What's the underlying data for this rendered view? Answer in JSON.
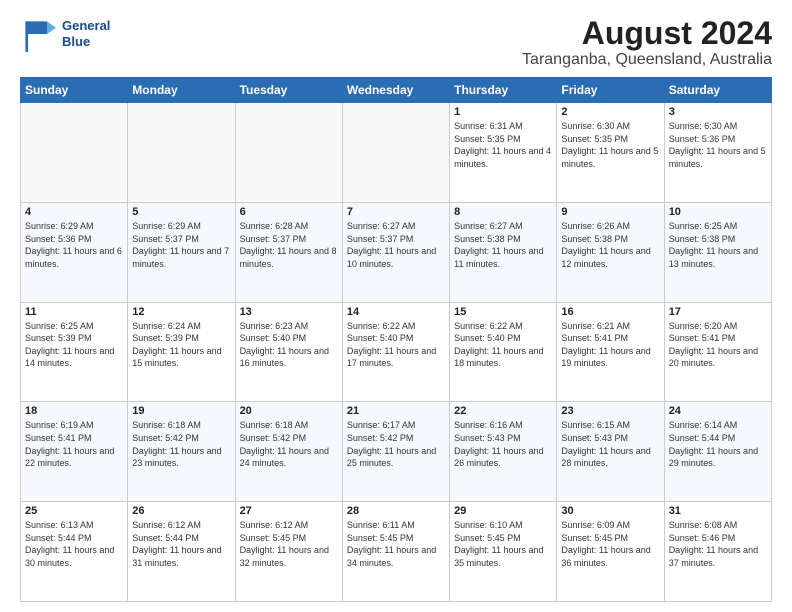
{
  "header": {
    "logo": {
      "line1": "General",
      "line2": "Blue"
    },
    "title": "August 2024",
    "subtitle": "Taranganba, Queensland, Australia"
  },
  "weekdays": [
    "Sunday",
    "Monday",
    "Tuesday",
    "Wednesday",
    "Thursday",
    "Friday",
    "Saturday"
  ],
  "weeks": [
    [
      {
        "day": "",
        "info": ""
      },
      {
        "day": "",
        "info": ""
      },
      {
        "day": "",
        "info": ""
      },
      {
        "day": "",
        "info": ""
      },
      {
        "day": "1",
        "info": "Sunrise: 6:31 AM\nSunset: 5:35 PM\nDaylight: 11 hours\nand 4 minutes."
      },
      {
        "day": "2",
        "info": "Sunrise: 6:30 AM\nSunset: 5:35 PM\nDaylight: 11 hours\nand 5 minutes."
      },
      {
        "day": "3",
        "info": "Sunrise: 6:30 AM\nSunset: 5:36 PM\nDaylight: 11 hours\nand 5 minutes."
      }
    ],
    [
      {
        "day": "4",
        "info": "Sunrise: 6:29 AM\nSunset: 5:36 PM\nDaylight: 11 hours\nand 6 minutes."
      },
      {
        "day": "5",
        "info": "Sunrise: 6:29 AM\nSunset: 5:37 PM\nDaylight: 11 hours\nand 7 minutes."
      },
      {
        "day": "6",
        "info": "Sunrise: 6:28 AM\nSunset: 5:37 PM\nDaylight: 11 hours\nand 8 minutes."
      },
      {
        "day": "7",
        "info": "Sunrise: 6:27 AM\nSunset: 5:37 PM\nDaylight: 11 hours\nand 10 minutes."
      },
      {
        "day": "8",
        "info": "Sunrise: 6:27 AM\nSunset: 5:38 PM\nDaylight: 11 hours\nand 11 minutes."
      },
      {
        "day": "9",
        "info": "Sunrise: 6:26 AM\nSunset: 5:38 PM\nDaylight: 11 hours\nand 12 minutes."
      },
      {
        "day": "10",
        "info": "Sunrise: 6:25 AM\nSunset: 5:38 PM\nDaylight: 11 hours\nand 13 minutes."
      }
    ],
    [
      {
        "day": "11",
        "info": "Sunrise: 6:25 AM\nSunset: 5:39 PM\nDaylight: 11 hours\nand 14 minutes."
      },
      {
        "day": "12",
        "info": "Sunrise: 6:24 AM\nSunset: 5:39 PM\nDaylight: 11 hours\nand 15 minutes."
      },
      {
        "day": "13",
        "info": "Sunrise: 6:23 AM\nSunset: 5:40 PM\nDaylight: 11 hours\nand 16 minutes."
      },
      {
        "day": "14",
        "info": "Sunrise: 6:22 AM\nSunset: 5:40 PM\nDaylight: 11 hours\nand 17 minutes."
      },
      {
        "day": "15",
        "info": "Sunrise: 6:22 AM\nSunset: 5:40 PM\nDaylight: 11 hours\nand 18 minutes."
      },
      {
        "day": "16",
        "info": "Sunrise: 6:21 AM\nSunset: 5:41 PM\nDaylight: 11 hours\nand 19 minutes."
      },
      {
        "day": "17",
        "info": "Sunrise: 6:20 AM\nSunset: 5:41 PM\nDaylight: 11 hours\nand 20 minutes."
      }
    ],
    [
      {
        "day": "18",
        "info": "Sunrise: 6:19 AM\nSunset: 5:41 PM\nDaylight: 11 hours\nand 22 minutes."
      },
      {
        "day": "19",
        "info": "Sunrise: 6:18 AM\nSunset: 5:42 PM\nDaylight: 11 hours\nand 23 minutes."
      },
      {
        "day": "20",
        "info": "Sunrise: 6:18 AM\nSunset: 5:42 PM\nDaylight: 11 hours\nand 24 minutes."
      },
      {
        "day": "21",
        "info": "Sunrise: 6:17 AM\nSunset: 5:42 PM\nDaylight: 11 hours\nand 25 minutes."
      },
      {
        "day": "22",
        "info": "Sunrise: 6:16 AM\nSunset: 5:43 PM\nDaylight: 11 hours\nand 26 minutes."
      },
      {
        "day": "23",
        "info": "Sunrise: 6:15 AM\nSunset: 5:43 PM\nDaylight: 11 hours\nand 28 minutes."
      },
      {
        "day": "24",
        "info": "Sunrise: 6:14 AM\nSunset: 5:44 PM\nDaylight: 11 hours\nand 29 minutes."
      }
    ],
    [
      {
        "day": "25",
        "info": "Sunrise: 6:13 AM\nSunset: 5:44 PM\nDaylight: 11 hours\nand 30 minutes."
      },
      {
        "day": "26",
        "info": "Sunrise: 6:12 AM\nSunset: 5:44 PM\nDaylight: 11 hours\nand 31 minutes."
      },
      {
        "day": "27",
        "info": "Sunrise: 6:12 AM\nSunset: 5:45 PM\nDaylight: 11 hours\nand 32 minutes."
      },
      {
        "day": "28",
        "info": "Sunrise: 6:11 AM\nSunset: 5:45 PM\nDaylight: 11 hours\nand 34 minutes."
      },
      {
        "day": "29",
        "info": "Sunrise: 6:10 AM\nSunset: 5:45 PM\nDaylight: 11 hours\nand 35 minutes."
      },
      {
        "day": "30",
        "info": "Sunrise: 6:09 AM\nSunset: 5:45 PM\nDaylight: 11 hours\nand 36 minutes."
      },
      {
        "day": "31",
        "info": "Sunrise: 6:08 AM\nSunset: 5:46 PM\nDaylight: 11 hours\nand 37 minutes."
      }
    ]
  ]
}
